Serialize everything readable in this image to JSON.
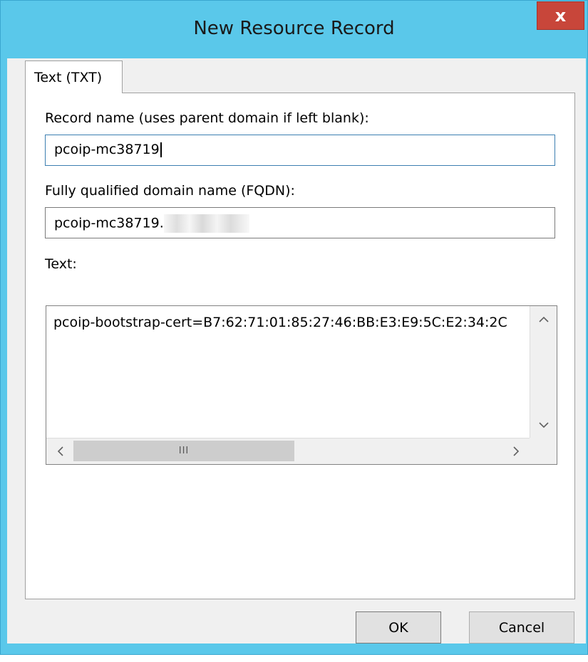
{
  "window": {
    "title": "New Resource Record",
    "close_label": "x"
  },
  "tab": {
    "label": "Text (TXT)"
  },
  "form": {
    "record_name_label": "Record name (uses parent domain if left blank):",
    "record_name_value": "pcoip-mc38719",
    "fqdn_label": "Fully qualified domain name (FQDN):",
    "fqdn_value": "pcoip-mc38719.",
    "text_label": "Text:",
    "text_value": "pcoip-bootstrap-cert=B7:62:71:01:85:27:46:BB:E3:E9:5C:E2:34:2C"
  },
  "scrollbars": {
    "up_icon": "chevron-up-icon",
    "down_icon": "chevron-down-icon",
    "left_icon": "chevron-left-icon",
    "right_icon": "chevron-right-icon",
    "thumb_grip": "III"
  },
  "buttons": {
    "ok_label": "OK",
    "cancel_label": "Cancel"
  },
  "colors": {
    "title_bar": "#5ac8ea",
    "close_button": "#c8463a",
    "dialog_background": "#f0f0f0",
    "focus_border": "#3c7fb1"
  }
}
